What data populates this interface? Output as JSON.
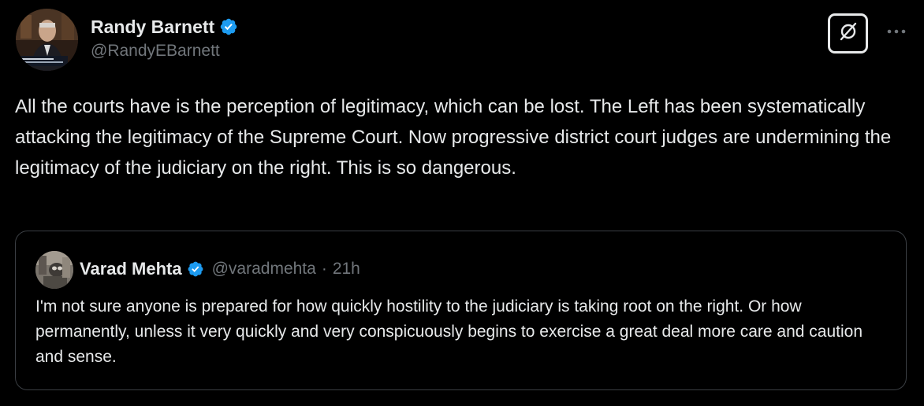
{
  "tweet": {
    "author": {
      "name": "Randy Barnett",
      "handle": "@RandyEBarnett",
      "verified": true
    },
    "text": "All the courts have is the perception of legitimacy, which can be lost. The Left has been systematically attacking the legitimacy of the Supreme Court. Now progressive district court judges are undermining the legitimacy of the judiciary on the right. This is so dangerous."
  },
  "quoted_tweet": {
    "author": {
      "name": "Varad Mehta",
      "handle": "@varadmehta",
      "verified": true
    },
    "separator": "·",
    "time": "21h",
    "text": "I'm not sure anyone is prepared for how quickly hostility to the judiciary is taking root on the right. Or how permanently, unless it very quickly and very conspicuously begins to exercise a great deal more care and caution and sense."
  },
  "icons": {
    "verified": "verified-badge-icon",
    "grok": "grok-icon",
    "more": "more-horizontal-icon"
  },
  "colors": {
    "background": "#000000",
    "text": "#e7e9ea",
    "secondary_text": "#71767b",
    "verified_badge": "#1d9bf0",
    "card_border": "#3b3f44"
  }
}
